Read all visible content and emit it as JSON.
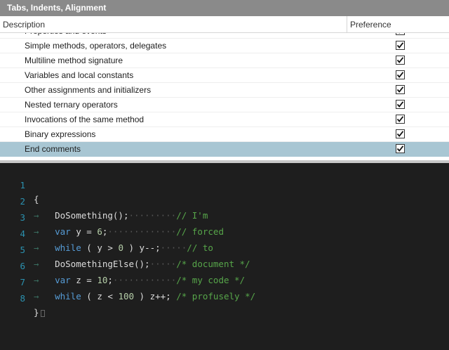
{
  "panel": {
    "title": "Tabs, Indents, Alignment",
    "columns": {
      "description": "Description",
      "preference": "Preference"
    },
    "rows": [
      {
        "label": "Properties and events",
        "checked": true
      },
      {
        "label": "Simple methods, operators, delegates",
        "checked": true
      },
      {
        "label": "Multiline method signature",
        "checked": true
      },
      {
        "label": "Variables and local constants",
        "checked": true
      },
      {
        "label": "Other assignments and initializers",
        "checked": true
      },
      {
        "label": "Nested ternary operators",
        "checked": true
      },
      {
        "label": "Invocations of the same method",
        "checked": true
      },
      {
        "label": "Binary expressions",
        "checked": true
      },
      {
        "label": "End comments",
        "checked": true,
        "selected": true
      }
    ]
  },
  "code": {
    "line_numbers": [
      "1",
      "2",
      "3",
      "4",
      "5",
      "6",
      "7",
      "8"
    ],
    "lines": [
      {
        "text": "{"
      },
      {
        "text": "DoSomething();",
        "comment": "// I'm"
      },
      {
        "text": "var y = 6;",
        "comment": "// forced"
      },
      {
        "text": "while ( y > 0 ) y--;",
        "comment": "// to"
      },
      {
        "text": "DoSomethingElse();",
        "comment": "/* document */"
      },
      {
        "text": "var z = 10;",
        "comment": "/* my code */"
      },
      {
        "text": "while ( z < 100 ) z++;",
        "comment": "/* profusely */"
      },
      {
        "text": "}"
      }
    ]
  },
  "colors": {
    "title_bar": "#8a8a8a",
    "selected_row": "#a8c6d3",
    "editor_bg": "#1e1e1e",
    "line_number": "#2b91af",
    "keyword": "#569cd6",
    "number": "#b5cea8",
    "comment": "#57a64a"
  }
}
